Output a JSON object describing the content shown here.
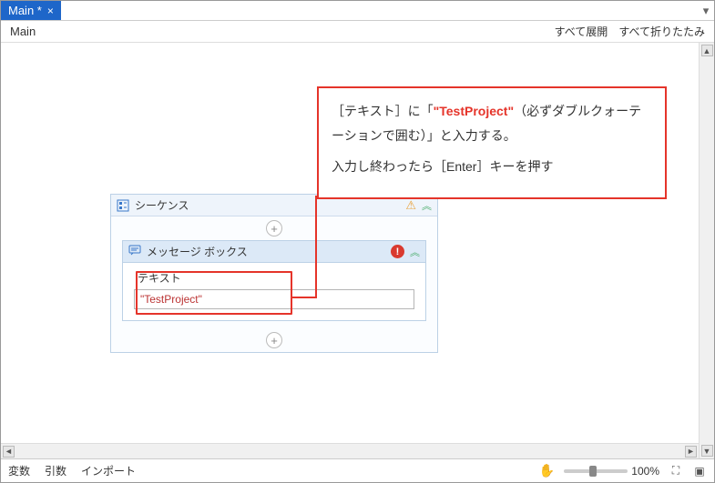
{
  "tab": {
    "label": "Main *",
    "close": "×"
  },
  "dropdown_chevron_glyph": "▾",
  "subheader": {
    "title": "Main",
    "expand_all": "すべて展開",
    "collapse_all": "すべて折りたたみ"
  },
  "callout": {
    "line1_pre": "［テキスト］に「",
    "line1_em": "\"TestProject\"",
    "line1_post": "（必ずダブルクォーテーションで囲む）」と入力する。",
    "line2": "入力し終わったら［Enter］キーを押す"
  },
  "sequence": {
    "title": "シーケンス",
    "warn_glyph": "⚠",
    "collapse_glyph": "︽",
    "plus_glyph": "+"
  },
  "messagebox": {
    "title": "メッセージ ボックス",
    "error_glyph": "!",
    "collapse_glyph": "︽",
    "field_label": "テキスト",
    "field_value": "\"TestProject\""
  },
  "scroll": {
    "up": "▲",
    "down": "▼",
    "left": "◄",
    "right": "►"
  },
  "footer": {
    "vars": "変数",
    "args": "引数",
    "imports": "インポート",
    "pan_glyph": "✋",
    "zoom_label": "100%",
    "fit_glyph": "⛶",
    "full_glyph": "▣"
  }
}
